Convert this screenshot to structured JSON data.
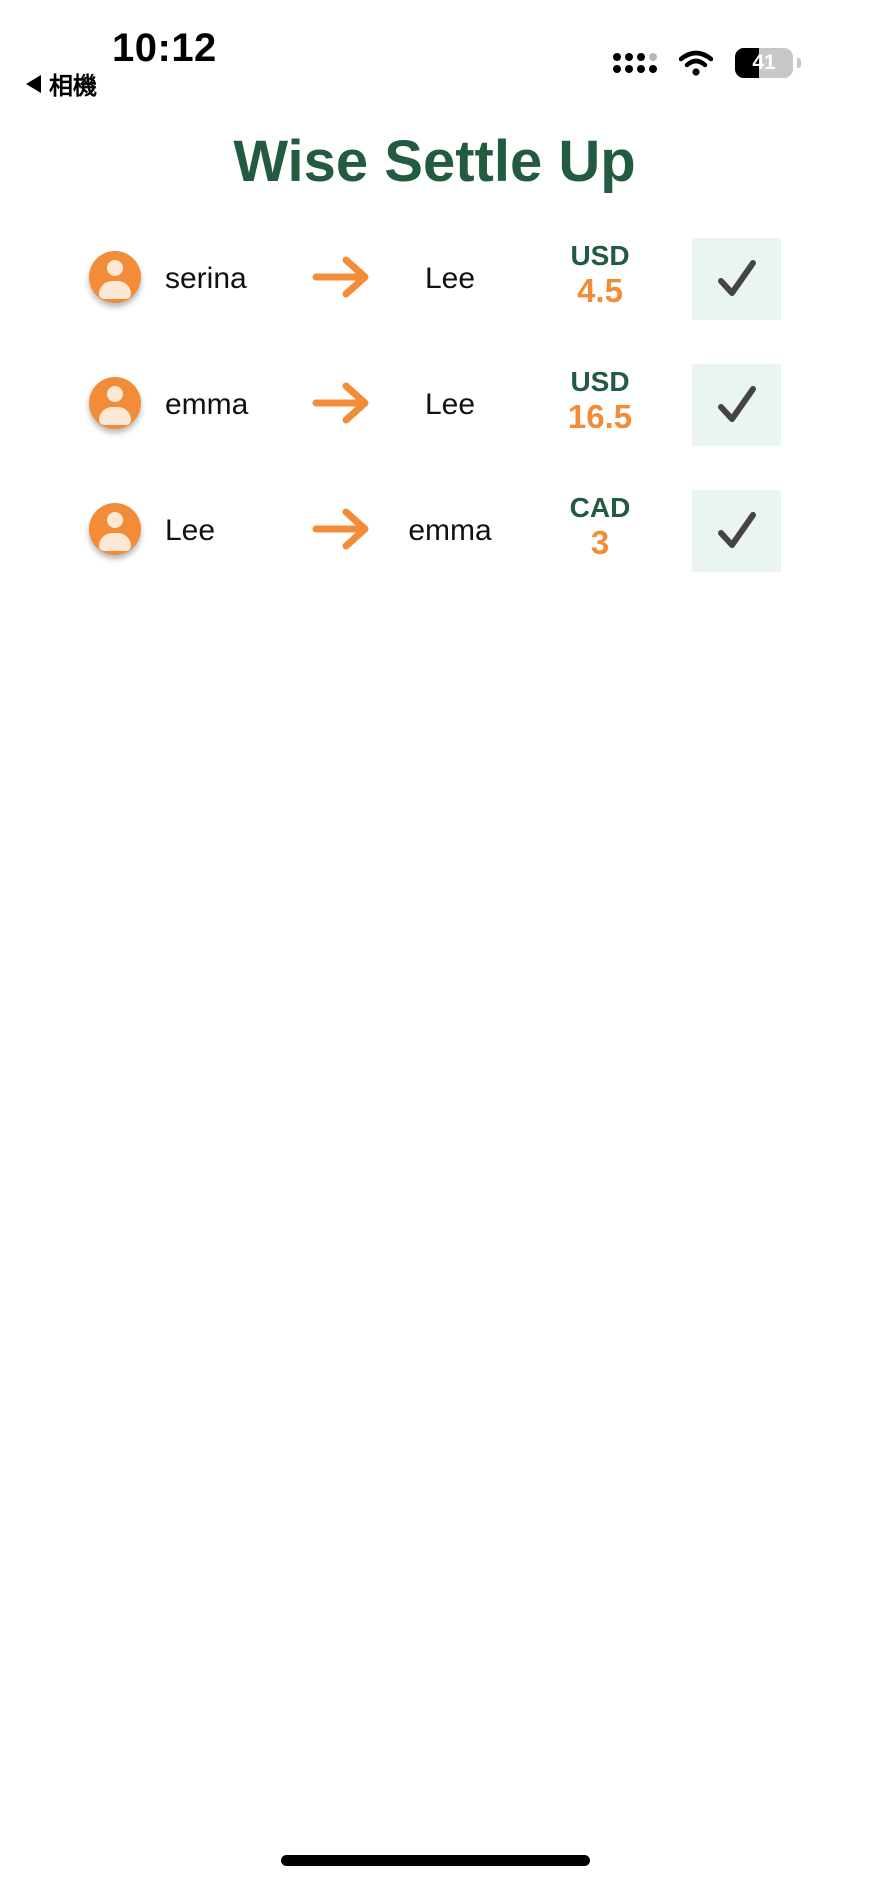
{
  "status_bar": {
    "time": "10:12",
    "back_label": "相機",
    "battery_level": "41",
    "battery_fraction": 0.41
  },
  "title": "Wise Settle Up",
  "settlements": [
    {
      "from": "serina",
      "to": "Lee",
      "currency": "USD",
      "amount": "4.5"
    },
    {
      "from": "emma",
      "to": "Lee",
      "currency": "USD",
      "amount": "16.5"
    },
    {
      "from": "Lee",
      "to": "emma",
      "currency": "CAD",
      "amount": "3"
    }
  ],
  "icons": {
    "avatar": "person-circle-icon",
    "arrow": "arrow-right-icon",
    "check": "checkmark-icon"
  },
  "colors": {
    "brand_green": "#225b40",
    "accent_orange": "#f28c38",
    "check_bg": "#eaf5f0"
  }
}
